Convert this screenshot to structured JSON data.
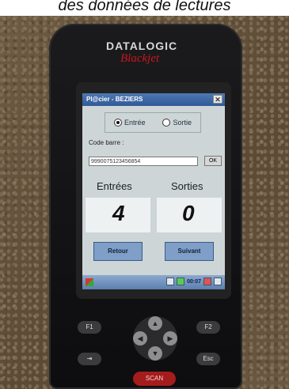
{
  "caption": "des données de lectures",
  "device": {
    "brand": "DATALOGIC",
    "model": "Blackjet"
  },
  "app": {
    "title": "Pl@cier - BEZIERS",
    "close_label": "✕",
    "mode": {
      "options": [
        "Entrée",
        "Sortie"
      ],
      "selected": "Entrée"
    },
    "barcode": {
      "label": "Code barre :",
      "value": "9990075123456854",
      "ok_label": "OK"
    },
    "counters": {
      "entries_label": "Entrées",
      "entries_value": "4",
      "exits_label": "Sorties",
      "exits_value": "0"
    },
    "buttons": {
      "back": "Retour",
      "next": "Suivant"
    },
    "taskbar": {
      "clock": "00:07"
    }
  },
  "keypad": {
    "f1": "F1",
    "f2": "F2",
    "esc": "Esc",
    "scan": "SCAN"
  }
}
